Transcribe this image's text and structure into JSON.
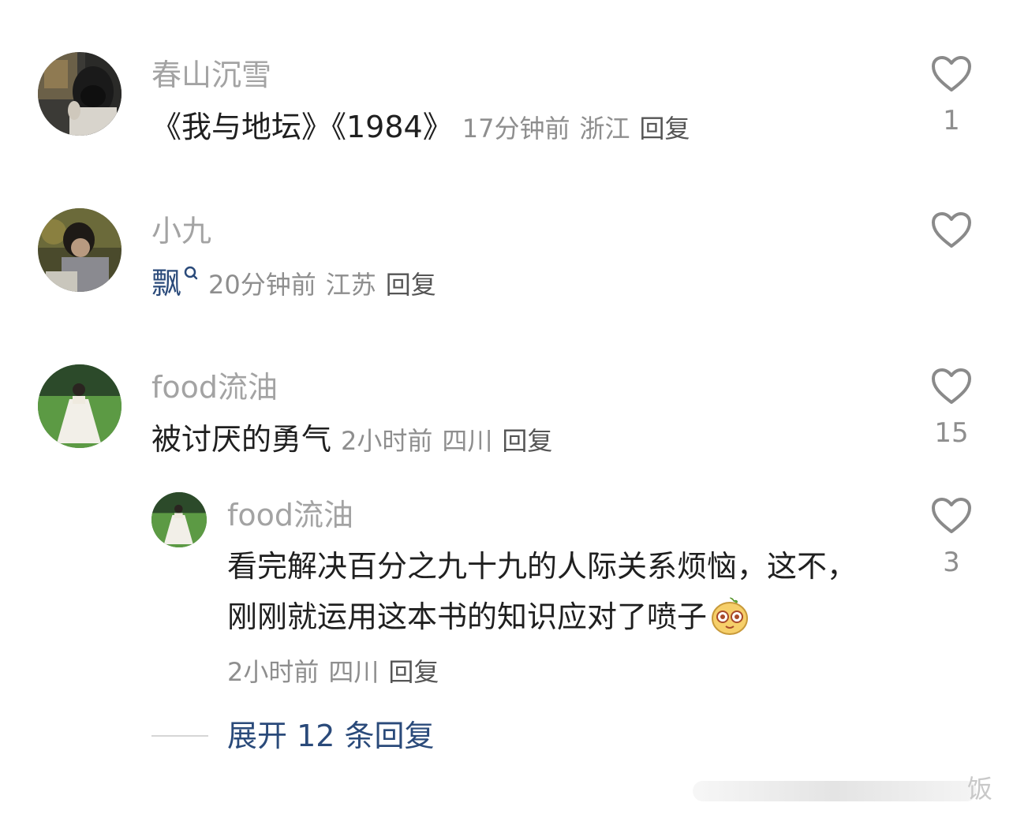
{
  "comments": [
    {
      "username": "春山沉雪",
      "text": "《我与地坛》《1984》",
      "time": "17分钟前",
      "location": "浙江",
      "reply_label": "回复",
      "likes": "1"
    },
    {
      "username": "小九",
      "keyword": "飘",
      "time": "20分钟前",
      "location": "江苏",
      "reply_label": "回复"
    },
    {
      "username": "food流油",
      "text": "被讨厌的勇气",
      "time": "2小时前",
      "location": "四川",
      "reply_label": "回复",
      "likes": "15",
      "reply": {
        "username": "food流油",
        "text": "看完解决百分之九十九的人际关系烦恼，这不，刚刚就运用这本书的知识应对了喷子",
        "time": "2小时前",
        "location": "四川",
        "reply_label": "回复",
        "likes": "3"
      },
      "expand_label": "展开 12 条回复"
    }
  ],
  "watermark": "饭",
  "colors": {
    "username": "#a3a3a3",
    "body": "#1f1f1f",
    "meta": "#8e8e8e",
    "link": "#2a4a7a",
    "heart": "#8a8a8a"
  },
  "icons": [
    "heart-outline-icon",
    "search-mini-icon",
    "emoji-face-icon"
  ]
}
